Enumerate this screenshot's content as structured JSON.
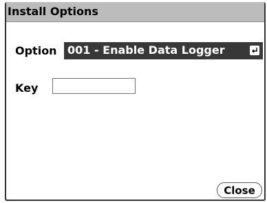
{
  "dialog": {
    "title": "Install Options"
  },
  "option": {
    "label": "Option",
    "selected_value": "001 - Enable Data Logger",
    "icon": "enter-icon"
  },
  "key": {
    "label": "Key",
    "value": "",
    "placeholder": ""
  },
  "close_button": {
    "label": "Close"
  },
  "colors": {
    "title_bar": "#bcbcbc",
    "selected_field": "#383838"
  }
}
